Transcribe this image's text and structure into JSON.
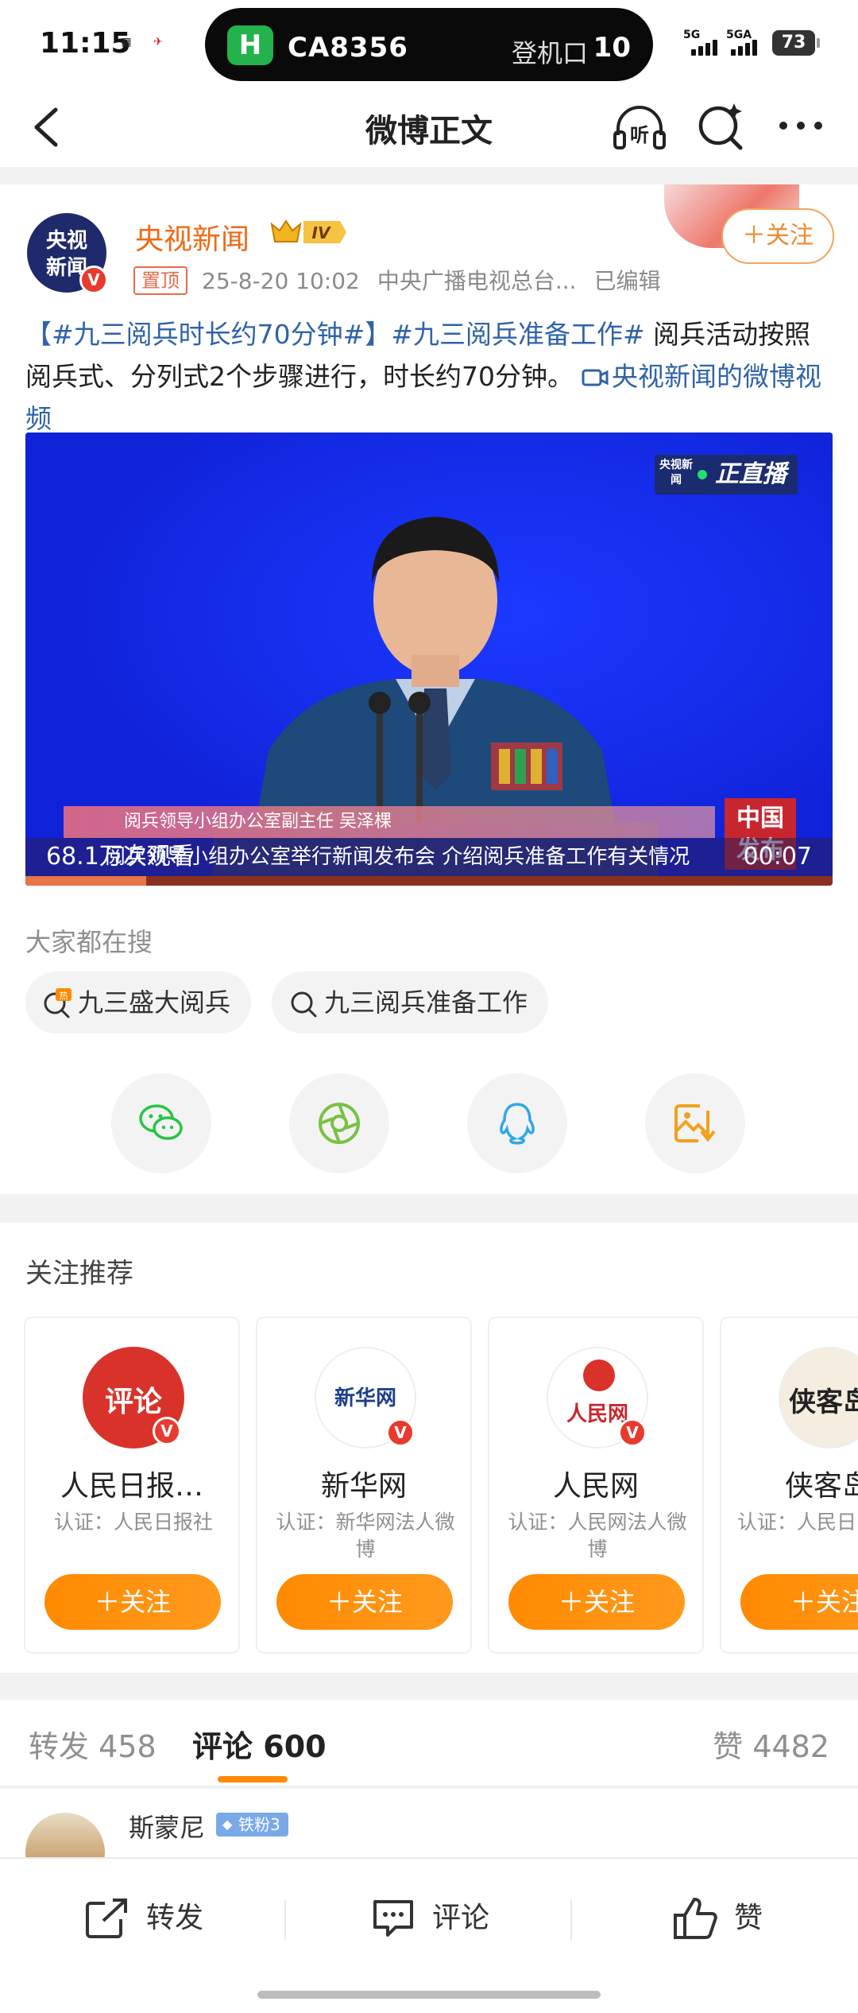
{
  "status_bar": {
    "time": "11:15",
    "flight": "CA8356",
    "gate_label": "登机口",
    "gate_number": "10",
    "net1": "5G",
    "net2": "5GA",
    "battery": "73"
  },
  "nav": {
    "title": "微博正文",
    "listen_label": "听"
  },
  "post": {
    "author": "央视新闻",
    "avatar_text_1": "央视",
    "avatar_text_2": "新闻",
    "level_badge": "IV",
    "follow": "＋关注",
    "pinned": "置顶",
    "time": "25-8-20 10:02",
    "source": "中央广播电视总台...",
    "edited": "已编辑",
    "topic1": "【#九三阅兵时长约70分钟#】",
    "topic2": "#九三阅兵准备工作#",
    "text": " 阅兵活动按照阅兵式、分列式2个步骤进行，时长约70分钟。",
    "video_link": "央视新闻的微博视频",
    "video": {
      "live_logo": "央视新闻",
      "live_text": "正直播",
      "lower_third": "阅兵领导小组办公室副主任 吴泽棵",
      "caption": "阅兵领导小组办公室举行新闻发布会 介绍阅兵准备工作有关情况",
      "cn_logo_1": "中国",
      "cn_logo_2": "发布",
      "views": "68.1万次观看",
      "duration": "00:07",
      "progress": 0.15
    }
  },
  "hot_search": {
    "title": "大家都在搜",
    "chips": [
      "九三盛大阅兵",
      "九三阅兵准备工作"
    ]
  },
  "share_icons": [
    "wechat-icon",
    "moments-icon",
    "qq-icon",
    "save-image-icon"
  ],
  "recommend": {
    "title": "关注推荐",
    "cards": [
      {
        "name": "人民日报…",
        "cert": "认证：人民日报社",
        "avatar": "评论",
        "follow": "＋关注"
      },
      {
        "name": "新华网",
        "cert": "认证：新华网法人微博",
        "avatar": "新华网",
        "follow": "＋关注"
      },
      {
        "name": "人民网",
        "cert": "认证：人民网法人微博",
        "avatar": "人民网",
        "follow": "＋关注"
      },
      {
        "name": "侠客岛",
        "cert": "认证：人民日",
        "avatar": "侠客岛",
        "follow": "＋关注"
      }
    ]
  },
  "tabs": {
    "repost": "转发",
    "repost_count": "458",
    "comment": "评论",
    "comment_count": "600",
    "like": "赞",
    "like_count": "4482"
  },
  "comment_preview": {
    "name": "斯蒙尼",
    "badge": "铁粉3"
  },
  "bottom_bar": {
    "repost": "转发",
    "comment": "评论",
    "like": "赞"
  },
  "colors": {
    "accent": "#ff8a00",
    "link": "#2f63a8",
    "author": "#ee6a14"
  }
}
